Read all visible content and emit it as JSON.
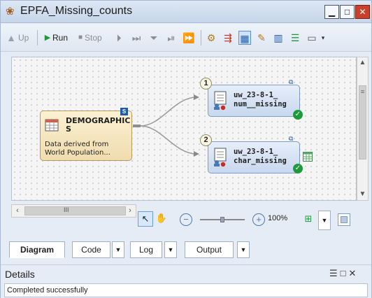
{
  "window": {
    "title": "EPFA_Missing_counts",
    "controls": {
      "minimize": "▁",
      "maximize": "□",
      "close": "✕"
    }
  },
  "toolbar": {
    "up_label": "Up",
    "run_label": "Run",
    "stop_label": "Stop"
  },
  "diagram": {
    "nodes": [
      {
        "kind": "data",
        "name": "DEMOGRAPHICS",
        "name_line1": "DEMOGRAPHIC",
        "name_line2": "S",
        "description": "Data derived from World Population...",
        "desc_line1": "Data derived from",
        "desc_line2": "World Population...",
        "badge": "S"
      },
      {
        "kind": "program",
        "sequence": "1",
        "name_line1": "uw_23-8-1_",
        "name_line2": "num__missing",
        "status": "completed"
      },
      {
        "kind": "program",
        "sequence": "2",
        "name_line1": "uw_23-8-1_",
        "name_line2": "char_missing",
        "status": "completed"
      }
    ]
  },
  "canvas_controls": {
    "zoom_level": "100%",
    "hscroll_grip": "III",
    "vscroll_grip": "≡"
  },
  "tabs": [
    {
      "label": "Diagram",
      "active": true
    },
    {
      "label": "Code",
      "active": false
    },
    {
      "label": "Log",
      "active": false
    },
    {
      "label": "Output",
      "active": false
    }
  ],
  "details": {
    "title": "Details",
    "status_text": "Completed successfully"
  },
  "colors": {
    "accent": "#1f5da8",
    "success": "#1f9a3a",
    "close_button": "#c9412d"
  }
}
